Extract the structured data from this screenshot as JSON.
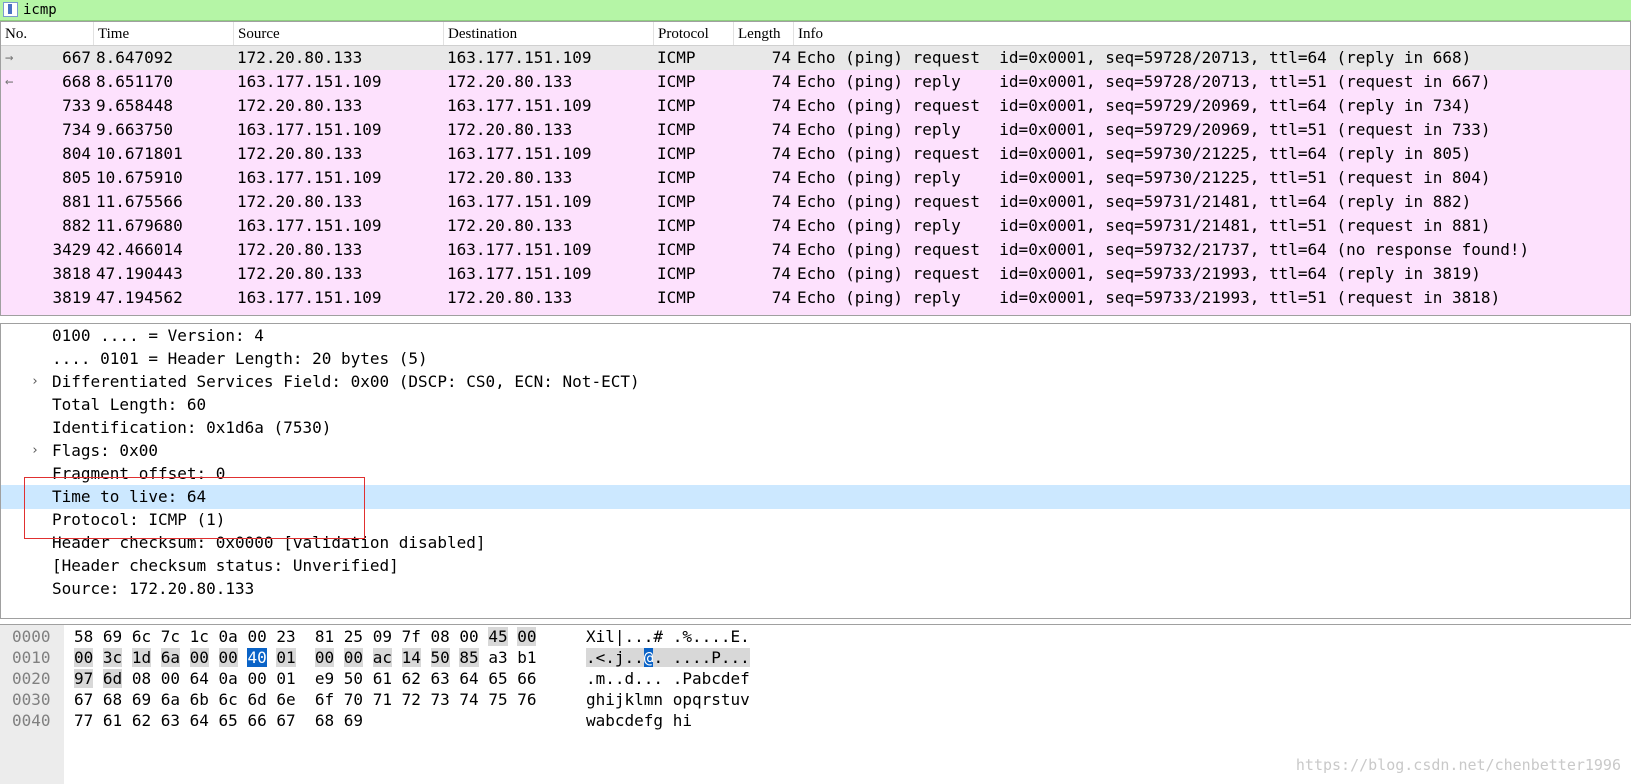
{
  "filter": {
    "value": "icmp"
  },
  "columns": [
    "No.",
    "Time",
    "Source",
    "Destination",
    "Protocol",
    "Length",
    "Info"
  ],
  "packets": [
    {
      "no": "667",
      "time": "8.647092",
      "src": "172.20.80.133",
      "dst": "163.177.151.109",
      "proto": "ICMP",
      "len": "74",
      "info": "Echo (ping) request  id=0x0001, seq=59728/20713, ttl=64 (reply in 668)"
    },
    {
      "no": "668",
      "time": "8.651170",
      "src": "163.177.151.109",
      "dst": "172.20.80.133",
      "proto": "ICMP",
      "len": "74",
      "info": "Echo (ping) reply    id=0x0001, seq=59728/20713, ttl=51 (request in 667)"
    },
    {
      "no": "733",
      "time": "9.658448",
      "src": "172.20.80.133",
      "dst": "163.177.151.109",
      "proto": "ICMP",
      "len": "74",
      "info": "Echo (ping) request  id=0x0001, seq=59729/20969, ttl=64 (reply in 734)"
    },
    {
      "no": "734",
      "time": "9.663750",
      "src": "163.177.151.109",
      "dst": "172.20.80.133",
      "proto": "ICMP",
      "len": "74",
      "info": "Echo (ping) reply    id=0x0001, seq=59729/20969, ttl=51 (request in 733)"
    },
    {
      "no": "804",
      "time": "10.671801",
      "src": "172.20.80.133",
      "dst": "163.177.151.109",
      "proto": "ICMP",
      "len": "74",
      "info": "Echo (ping) request  id=0x0001, seq=59730/21225, ttl=64 (reply in 805)"
    },
    {
      "no": "805",
      "time": "10.675910",
      "src": "163.177.151.109",
      "dst": "172.20.80.133",
      "proto": "ICMP",
      "len": "74",
      "info": "Echo (ping) reply    id=0x0001, seq=59730/21225, ttl=51 (request in 804)"
    },
    {
      "no": "881",
      "time": "11.675566",
      "src": "172.20.80.133",
      "dst": "163.177.151.109",
      "proto": "ICMP",
      "len": "74",
      "info": "Echo (ping) request  id=0x0001, seq=59731/21481, ttl=64 (reply in 882)"
    },
    {
      "no": "882",
      "time": "11.679680",
      "src": "163.177.151.109",
      "dst": "172.20.80.133",
      "proto": "ICMP",
      "len": "74",
      "info": "Echo (ping) reply    id=0x0001, seq=59731/21481, ttl=51 (request in 881)"
    },
    {
      "no": "3429",
      "time": "42.466014",
      "src": "172.20.80.133",
      "dst": "163.177.151.109",
      "proto": "ICMP",
      "len": "74",
      "info": "Echo (ping) request  id=0x0001, seq=59732/21737, ttl=64 (no response found!)"
    },
    {
      "no": "3818",
      "time": "47.190443",
      "src": "172.20.80.133",
      "dst": "163.177.151.109",
      "proto": "ICMP",
      "len": "74",
      "info": "Echo (ping) request  id=0x0001, seq=59733/21993, ttl=64 (reply in 3819)"
    },
    {
      "no": "3819",
      "time": "47.194562",
      "src": "163.177.151.109",
      "dst": "172.20.80.133",
      "proto": "ICMP",
      "len": "74",
      "info": "Echo (ping) reply    id=0x0001, seq=59733/21993, ttl=51 (request in 3818)"
    }
  ],
  "details": [
    {
      "text": "0100 .... = Version: 4",
      "expandable": false
    },
    {
      "text": ".... 0101 = Header Length: 20 bytes (5)",
      "expandable": false
    },
    {
      "text": "Differentiated Services Field: 0x00 (DSCP: CS0, ECN: Not-ECT)",
      "expandable": true
    },
    {
      "text": "Total Length: 60",
      "expandable": false
    },
    {
      "text": "Identification: 0x1d6a (7530)",
      "expandable": false
    },
    {
      "text": "Flags: 0x00",
      "expandable": true
    },
    {
      "text": "Fragment offset: 0",
      "expandable": false
    },
    {
      "text": "Time to live: 64",
      "expandable": false,
      "selected": true
    },
    {
      "text": "Protocol: ICMP (1)",
      "expandable": false
    },
    {
      "text": "Header checksum: 0x0000 [validation disabled]",
      "expandable": false
    },
    {
      "text": "[Header checksum status: Unverified]",
      "expandable": false
    },
    {
      "text": "Source: 172.20.80.133",
      "expandable": false
    }
  ],
  "bytes": [
    {
      "offset": "0000",
      "hex": [
        "58",
        "69",
        "6c",
        "7c",
        "1c",
        "0a",
        "00",
        "23",
        "81",
        "25",
        "09",
        "7f",
        "08",
        "00",
        "45",
        "00"
      ],
      "ascii": "Xil|...# .%....E."
    },
    {
      "offset": "0010",
      "hex": [
        "00",
        "3c",
        "1d",
        "6a",
        "00",
        "00",
        "40",
        "01",
        "00",
        "00",
        "ac",
        "14",
        "50",
        "85",
        "a3",
        "b1"
      ],
      "ascii": ".<.j..@. ....P..."
    },
    {
      "offset": "0020",
      "hex": [
        "97",
        "6d",
        "08",
        "00",
        "64",
        "0a",
        "00",
        "01",
        "e9",
        "50",
        "61",
        "62",
        "63",
        "64",
        "65",
        "66"
      ],
      "ascii": ".m..d... .Pabcdef"
    },
    {
      "offset": "0030",
      "hex": [
        "67",
        "68",
        "69",
        "6a",
        "6b",
        "6c",
        "6d",
        "6e",
        "6f",
        "70",
        "71",
        "72",
        "73",
        "74",
        "75",
        "76"
      ],
      "ascii": "ghijklmn opqrstuv"
    },
    {
      "offset": "0040",
      "hex": [
        "77",
        "61",
        "62",
        "63",
        "64",
        "65",
        "66",
        "67",
        "68",
        "69"
      ],
      "ascii": "wabcdefg hi"
    }
  ],
  "watermark": "https://blog.csdn.net/chenbetter1996"
}
